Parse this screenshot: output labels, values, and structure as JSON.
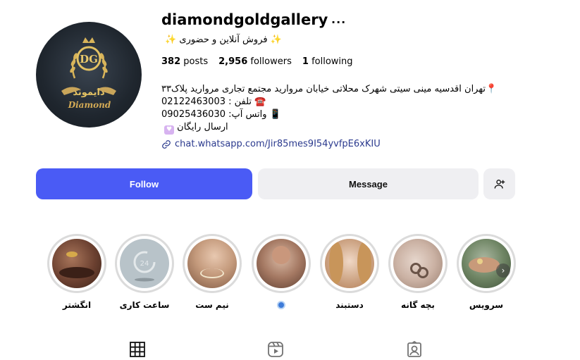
{
  "profile": {
    "username": "diamondgoldgallery",
    "subtitle": "فروش آنلاین و حضوری",
    "sparkle": "✨",
    "avatar_text": "Diamond",
    "avatar_persian": "دایموند",
    "avatar_monogram": "DG"
  },
  "stats": {
    "posts_count": "382",
    "posts_label": "posts",
    "followers_count": "2,956",
    "followers_label": "followers",
    "following_count": "1",
    "following_label": "following"
  },
  "bio": {
    "line1": "📍تهران اقدسیه مینی سیتی شهرک محلاتی خیابان مروارید مجتمع تجاری مروارید پلاک۳۳",
    "line2": "02122463003 : تلفن ☎️",
    "line3": "09025436030 :واتس آپ 📱",
    "line4": "ارسال رایگان"
  },
  "link": {
    "text": "chat.whatsapp.com/Jir85mes9I54yvfpE6xKIU"
  },
  "buttons": {
    "follow": "Follow",
    "message": "Message"
  },
  "highlights": [
    {
      "label": "انگشتر"
    },
    {
      "label": "ساعت کاری"
    },
    {
      "label": "نیم ست"
    },
    {
      "label": ""
    },
    {
      "label": "دستبند"
    },
    {
      "label": "بچه گانه"
    },
    {
      "label": "سرویس"
    }
  ],
  "icons": {
    "more": "more-icon",
    "link": "link-icon",
    "add_user": "add-user-icon",
    "next": "chevron-right-icon",
    "tabs": [
      "grid-icon",
      "reels-icon",
      "tagged-icon"
    ]
  },
  "colors": {
    "follow_button": "#4a5bf5",
    "secondary_button": "#efeff2",
    "link": "#2b3a8e"
  }
}
